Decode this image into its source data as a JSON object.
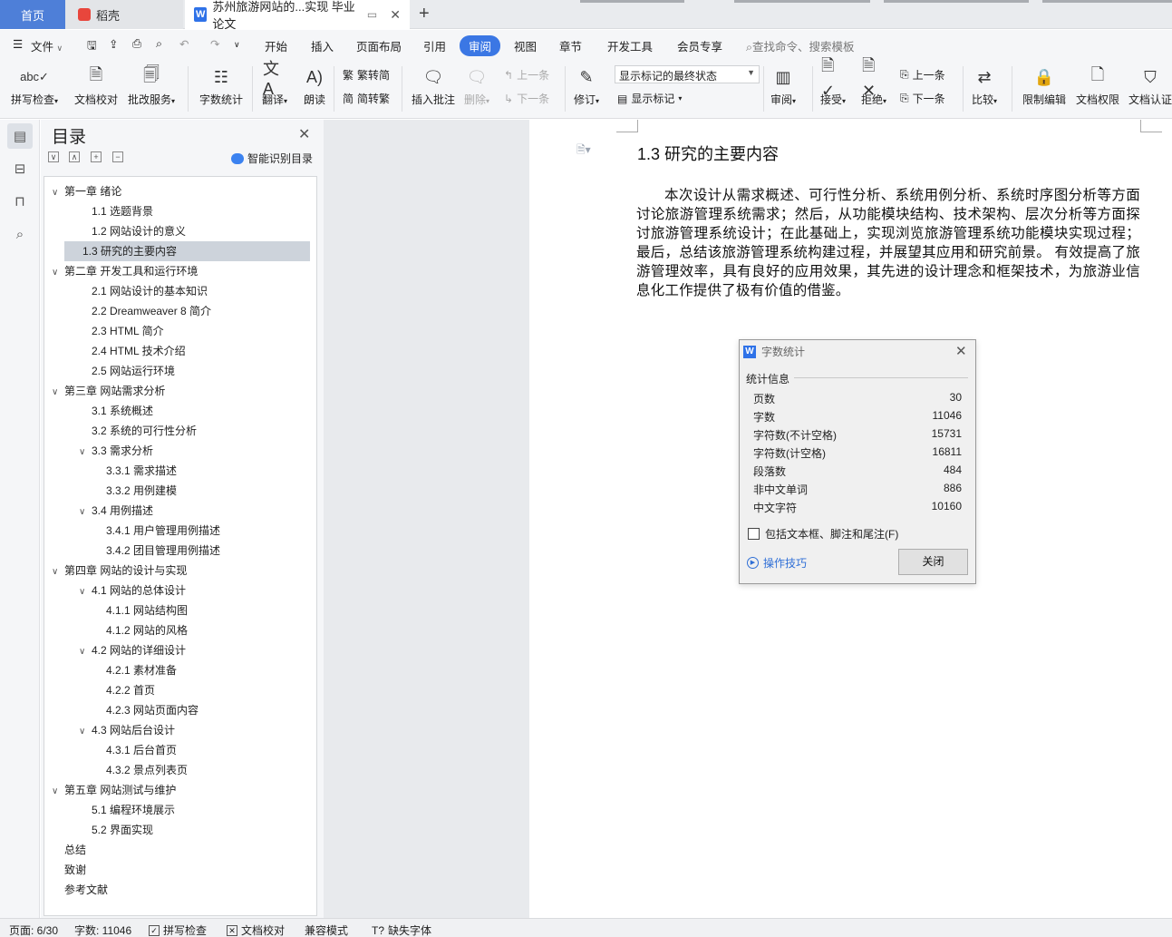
{
  "tabs": {
    "home": "首页",
    "daoke": "稻壳",
    "doc": "苏州旅游网站的...实现 毕业论文",
    "new_tab": "+"
  },
  "menu": {
    "file": "文件",
    "items": [
      "开始",
      "插入",
      "页面布局",
      "引用",
      "审阅",
      "视图",
      "章节",
      "开发工具",
      "会员专享"
    ],
    "search_placeholder": "查找命令、搜索模板"
  },
  "ribbon": {
    "spell_check": "拼写检查",
    "doc_proof": "文档校对",
    "revise_service": "批改服务",
    "word_count": "字数统计",
    "translate": "翻译",
    "read_aloud": "朗读",
    "to_traditional": "繁转简",
    "to_simplified": "简转繁",
    "insert_comment": "插入批注",
    "delete": "删除",
    "prev_comment": "上一条",
    "next_comment": "下一条",
    "track_changes": "修订",
    "markup_state": "显示标记的最终状态",
    "show_markup": "显示标记",
    "review": "审阅",
    "accept": "接受",
    "reject": "拒绝",
    "prev_change": "上一条",
    "next_change": "下一条",
    "compare": "比较",
    "restrict_edit": "限制编辑",
    "doc_permission": "文档权限",
    "doc_cert": "文档认证"
  },
  "toc": {
    "title": "目录",
    "smart_label": "智能识别目录",
    "items": [
      {
        "label": "第一章  绪论",
        "level": 0,
        "caret": "v"
      },
      {
        "label": "1.1 选题背景",
        "level": 1,
        "caret": ""
      },
      {
        "label": "1.2 网站设计的意义",
        "level": 1,
        "caret": ""
      },
      {
        "label": "1.3 研究的主要内容",
        "level": 1,
        "caret": "",
        "selected": true
      },
      {
        "label": "第二章  开发工具和运行环境",
        "level": 0,
        "caret": "v"
      },
      {
        "label": "2.1 网站设计的基本知识",
        "level": 1,
        "caret": ""
      },
      {
        "label": "2.2 Dreamweaver 8 简介",
        "level": 1,
        "caret": ""
      },
      {
        "label": "2.3 HTML 简介",
        "level": 1,
        "caret": ""
      },
      {
        "label": "2.4 HTML 技术介绍",
        "level": 1,
        "caret": ""
      },
      {
        "label": "2.5 网站运行环境",
        "level": 1,
        "caret": ""
      },
      {
        "label": "第三章  网站需求分析",
        "level": 0,
        "caret": "v"
      },
      {
        "label": "3.1  系统概述",
        "level": 1,
        "caret": ""
      },
      {
        "label": "3.2  系统的可行性分析",
        "level": 1,
        "caret": ""
      },
      {
        "label": "3.3 需求分析",
        "level": 1,
        "caret": "v"
      },
      {
        "label": "3.3.1 需求描述",
        "level": 2,
        "caret": ""
      },
      {
        "label": "3.3.2 用例建模",
        "level": 2,
        "caret": ""
      },
      {
        "label": "3.4 用例描述",
        "level": 1,
        "caret": "v"
      },
      {
        "label": "3.4.1 用户管理用例描述",
        "level": 2,
        "caret": ""
      },
      {
        "label": "3.4.2 团目管理用例描述",
        "level": 2,
        "caret": ""
      },
      {
        "label": "第四章  网站的设计与实现",
        "level": 0,
        "caret": "v"
      },
      {
        "label": "4.1 网站的总体设计",
        "level": 1,
        "caret": "v"
      },
      {
        "label": "4.1.1 网站结构图",
        "level": 2,
        "caret": ""
      },
      {
        "label": "4.1.2 网站的风格",
        "level": 2,
        "caret": ""
      },
      {
        "label": "4.2 网站的详细设计",
        "level": 1,
        "caret": "v"
      },
      {
        "label": "4.2.1 素材准备",
        "level": 2,
        "caret": ""
      },
      {
        "label": "4.2.2 首页",
        "level": 2,
        "caret": ""
      },
      {
        "label": "4.2.3 网站页面内容",
        "level": 2,
        "caret": ""
      },
      {
        "label": "4.3 网站后台设计",
        "level": 1,
        "caret": "v"
      },
      {
        "label": "4.3.1 后台首页",
        "level": 2,
        "caret": ""
      },
      {
        "label": "4.3.2 景点列表页",
        "level": 2,
        "caret": ""
      },
      {
        "label": "第五章  网站测试与维护",
        "level": 0,
        "caret": "v"
      },
      {
        "label": "5.1 编程环境展示",
        "level": 1,
        "caret": ""
      },
      {
        "label": "5.2 界面实现",
        "level": 1,
        "caret": ""
      },
      {
        "label": "总结",
        "level": 0,
        "caret": ""
      },
      {
        "label": "致谢",
        "level": 0,
        "caret": ""
      },
      {
        "label": "参考文献",
        "level": 0,
        "caret": ""
      }
    ]
  },
  "document": {
    "heading": "1.3 研究的主要内容",
    "paragraph": "本次设计从需求概述、可行性分析、系统用例分析、系统时序图分析等方面讨论旅游管理系统需求；然后，从功能模块结构、技术架构、层次分析等方面探讨旅游管理系统设计；在此基础上，实现浏览旅游管理系统功能模块实现过程；最后，总结该旅游管理系统构建过程，并展望其应用和研究前景。  有效提高了旅游管理效率，具有良好的应用效果，其先进的设计理念和框架技术，为旅游业信息化工作提供了极有价值的借鉴。"
  },
  "dialog": {
    "title": "字数统计",
    "section": "统计信息",
    "stats": [
      {
        "label": "页数",
        "value": "30"
      },
      {
        "label": "字数",
        "value": "11046"
      },
      {
        "label": "字符数(不计空格)",
        "value": "15731"
      },
      {
        "label": "字符数(计空格)",
        "value": "16811"
      },
      {
        "label": "段落数",
        "value": "484"
      },
      {
        "label": "非中文单词",
        "value": "886"
      },
      {
        "label": "中文字符",
        "value": "10160"
      }
    ],
    "include_label": "包括文本框、脚注和尾注(F)",
    "tips": "操作技巧",
    "close": "关闭"
  },
  "status": {
    "page": "页面: 6/30",
    "words": "字数: 11046",
    "spell": "拼写检查",
    "proof": "文档校对",
    "compat": "兼容模式",
    "missing_font": "缺失字体"
  }
}
